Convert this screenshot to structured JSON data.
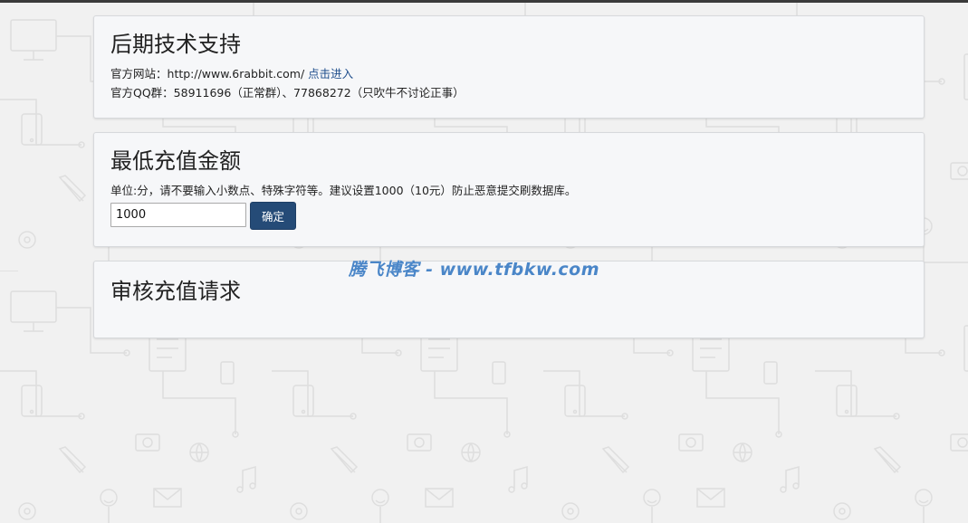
{
  "support": {
    "title": "后期技术支持",
    "site_label": "官方网站：",
    "site_url": "http://www.6rabbit.com/",
    "site_link": "点击进入",
    "qq_line": "官方QQ群：58911696（正常群）、77868272（只吹牛不讨论正事）"
  },
  "min_recharge": {
    "title": "最低充值金额",
    "description": "单位:分，请不要输入小数点、特殊字符等。建议设置1000（10元）防止恶意提交刷数据库。",
    "amount_value": "1000",
    "confirm_label": "确定"
  },
  "review": {
    "title": "审核充值请求"
  },
  "watermark": {
    "text": "腾飞博客 - www.tfbkw.com"
  },
  "colors": {
    "button_bg": "#254b77",
    "link": "#1f4e8c",
    "watermark": "#4a86c8",
    "panel_bg": "#f6f7f9",
    "page_bg": "#f1f1f1"
  }
}
